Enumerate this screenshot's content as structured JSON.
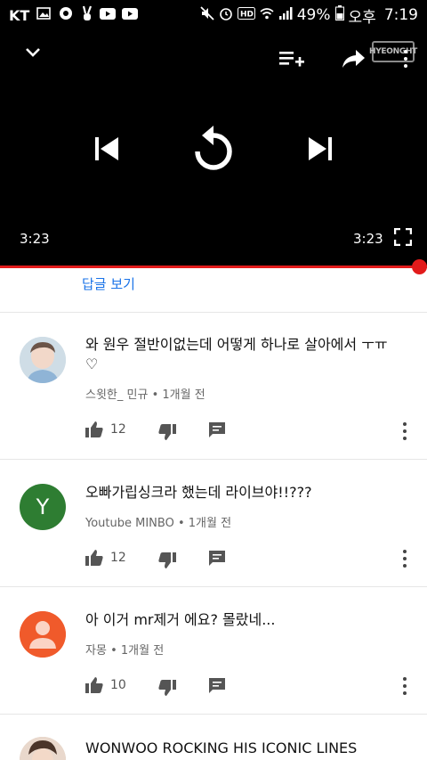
{
  "status_bar": {
    "carrier": "KT",
    "battery": "49%",
    "ampm": "오후",
    "time": "7:19"
  },
  "player": {
    "current_time": "3:23",
    "duration": "3:23",
    "progress": 1.0,
    "watermark": "HYEONGHT"
  },
  "see_replies": "답글 보기",
  "comments": [
    {
      "text": "와 원우 절반이없는데 어떻게 하나로 살아에서 ㅜㅠ♡",
      "author": "스윗한_ 민규",
      "separator": "•",
      "time": "1개월 전",
      "likes": "12",
      "avatar": "photo",
      "avatar_color": "#cfdde6"
    },
    {
      "text": "오빠가립싱크라 했는데 라이브야!!???",
      "author": "Youtube MINBO",
      "separator": "•",
      "time": "1개월 전",
      "likes": "12",
      "avatar": "letter",
      "avatar_letter": "Y",
      "avatar_color": "#2e7d32"
    },
    {
      "text": "아 이거 mr제거 에요? 몰랐네...",
      "author": "자몽",
      "separator": "•",
      "time": "1개월 전",
      "likes": "10",
      "avatar": "default",
      "avatar_color": "#f05a2b"
    },
    {
      "text": "WONWOO ROCKING HIS ICONIC LINES",
      "avatar": "photo",
      "avatar_color": "#d9c4b3"
    }
  ]
}
